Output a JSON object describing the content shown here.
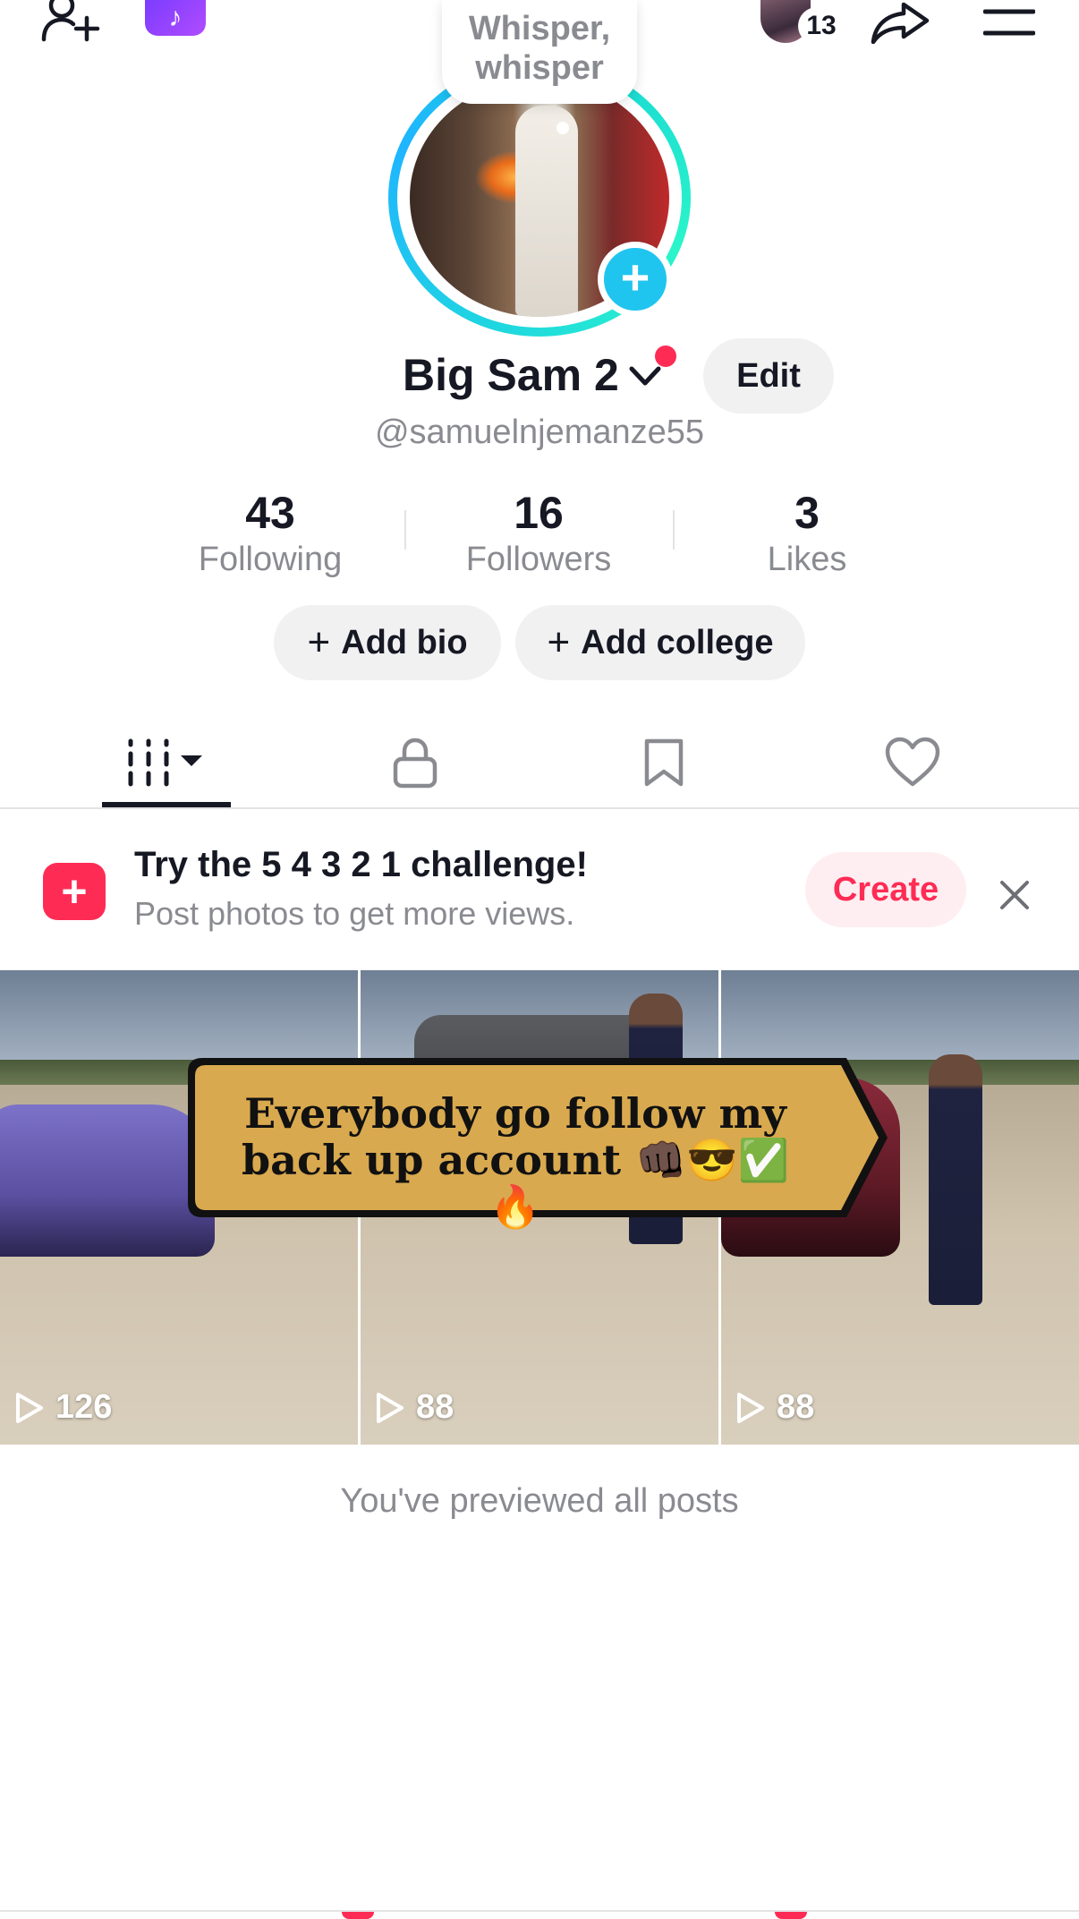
{
  "topbar": {
    "tiktok_badge": "♪",
    "story_count": "13"
  },
  "profile": {
    "note_line1": "Whisper,",
    "note_line2": "whisper",
    "display_name": "Big Sam 2",
    "edit_label": "Edit",
    "username": "@samuelnjemanze55"
  },
  "stats": [
    {
      "value": "43",
      "label": "Following"
    },
    {
      "value": "16",
      "label": "Followers"
    },
    {
      "value": "3",
      "label": "Likes"
    }
  ],
  "actions": {
    "add_bio": "Add bio",
    "add_college": "Add college"
  },
  "challenge": {
    "title": "Try the 5 4 3 2 1 challenge!",
    "subtitle": "Post photos to get more views.",
    "create_label": "Create"
  },
  "posts": [
    {
      "views": "126"
    },
    {
      "views": "88"
    },
    {
      "views": "88"
    }
  ],
  "banner": {
    "line1": "Everybody go follow my",
    "line2": "back up account 👊🏿😎✅🔥"
  },
  "footer_text": "You've previewed all posts",
  "colors": {
    "accent": "#fe2c55",
    "ring": "#1fd6e0",
    "plus_badge": "#20c5ef",
    "banner_fill": "#d9a94f"
  }
}
